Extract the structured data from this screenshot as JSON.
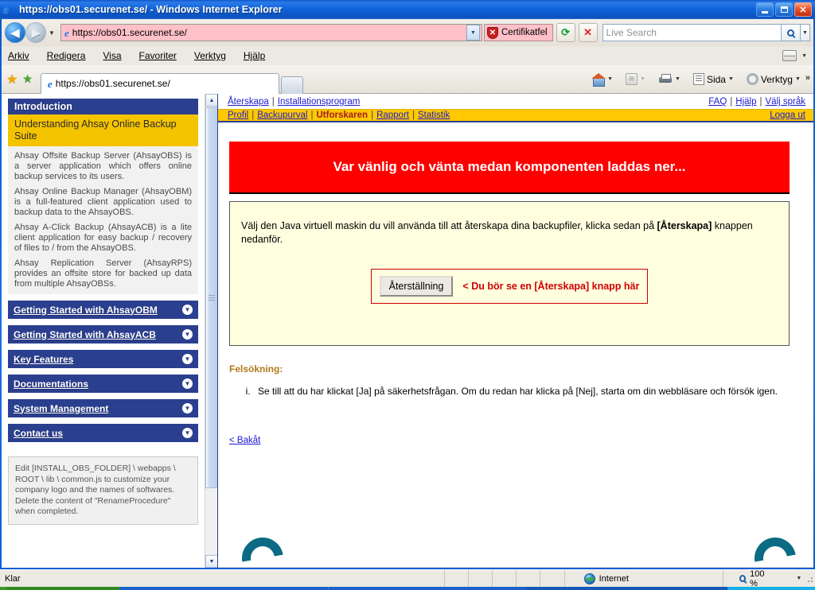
{
  "window": {
    "title": "https://obs01.securenet.se/ - Windows Internet Explorer",
    "minimize_label": "Minimera",
    "restore_label": "Återställ",
    "close_label": "Stäng"
  },
  "toolbar": {
    "back_label": "Tillbaka",
    "forward_label": "Framåt",
    "history_caret": "▼",
    "address_value": "https://obs01.securenet.se/",
    "address_dropdown": "▼",
    "certificate_error_label": "Certifikatfel",
    "refresh_label": "Uppdatera",
    "stop_label": "Stoppa",
    "search_placeholder": "Live Search",
    "search_caret": "▼"
  },
  "menu": {
    "items": [
      {
        "label": "Arkiv",
        "accel": "A"
      },
      {
        "label": "Redigera",
        "accel": "R"
      },
      {
        "label": "Visa",
        "accel": "s"
      },
      {
        "label": "Favoriter",
        "accel": "F"
      },
      {
        "label": "Verktyg",
        "accel": "V"
      },
      {
        "label": "Hjälp",
        "accel": "H"
      }
    ]
  },
  "favbar": {
    "favorites_star": "★",
    "add_favorite": "★",
    "tab_title": "https://obs01.securenet.se/",
    "new_tab_label": "",
    "commands": [
      {
        "name": "home",
        "label": ""
      },
      {
        "name": "feeds",
        "label": ""
      },
      {
        "name": "print",
        "label": ""
      },
      {
        "name": "page",
        "label": "Sida"
      },
      {
        "name": "tools",
        "label": "Verktyg"
      }
    ],
    "overflow": "»"
  },
  "sidebar": {
    "panel_header": "Introduction",
    "panel_title": "Understanding Ahsay Online Backup Suite",
    "paragraphs": [
      "Ahsay Offsite Backup Server (AhsayOBS) is a server application which offers online backup services to its users.",
      "Ahsay Online Backup Manager (AhsayOBM) is a full-featured client application used to backup data to the AhsayOBS.",
      "Ahsay A-Click Backup (AhsayACB) is a lite client application for easy backup / recovery of files to / from the AhsayOBS.",
      "Ahsay Replication Server (AhsayRPS) provides an offsite store for backed up data from multiple AhsayOBSs."
    ],
    "nav_items": [
      "Getting Started with AhsayOBM",
      "Getting Started with AhsayACB",
      "Key Features",
      "Documentations",
      "System Management",
      "Contact us"
    ],
    "note": "Edit [INSTALL_OBS_FOLDER] \\ webapps \\ ROOT \\ lib \\ common.js to customize your company logo and the names of softwares. Delete the content of \"RenameProcedure\" when completed."
  },
  "topnav": {
    "left_links": [
      "Återskapa",
      "Installationsprogram"
    ],
    "right_links": [
      "FAQ",
      "Hjälp",
      "Välj språk"
    ],
    "tabs": [
      {
        "label": "Profil",
        "active": false
      },
      {
        "label": "Backupurval",
        "active": false
      },
      {
        "label": "Utforskaren",
        "active": true
      },
      {
        "label": "Rapport",
        "active": false
      },
      {
        "label": "Statistik",
        "active": false
      }
    ],
    "logout": "Logga ut",
    "separator": "|"
  },
  "main": {
    "banner": "Var vänlig och vänta medan komponenten laddas ner...",
    "instruction_prefix": "Välj den Java virtuell maskin du vill använda till att återskapa dina backupfiler, klicka sedan på ",
    "instruction_bold": "[Återskapa]",
    "instruction_suffix": " knappen nedanför.",
    "java_button": "Återställning",
    "hint": "< Du bör se en [Återskapa] knapp här",
    "troubleshoot_title": "Felsökning:",
    "troubleshoot_items": [
      "Se till att du har klickat [Ja] på säkerhetsfrågan. Om du redan har klicka på [Nej], starta om din webbläsare och försök igen."
    ],
    "back_link": "< Bakåt"
  },
  "statusbar": {
    "status": "Klar",
    "zone": "Internet",
    "zoom": "100 %",
    "zoom_caret": "▼"
  },
  "colors": {
    "title_blue": "#0a5cd6",
    "nav_blue": "#2b3f8f",
    "accent_yellow": "#ffc800",
    "panel_yellow": "#f5c400",
    "banner_red": "#ff0000",
    "hint_red": "#d00000",
    "cert_pink": "#ffc0c8",
    "troubleshoot_gold": "#b07a1a",
    "logo_teal": "#0b6b84"
  }
}
